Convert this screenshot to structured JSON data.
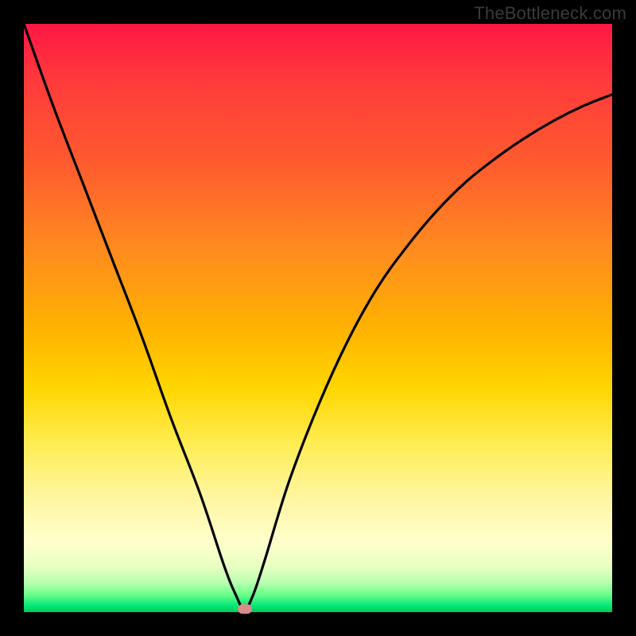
{
  "watermark": "TheBottleneck.com",
  "chart_data": {
    "type": "line",
    "title": "",
    "xlabel": "",
    "ylabel": "",
    "xlim": [
      0,
      100
    ],
    "ylim": [
      0,
      100
    ],
    "series": [
      {
        "name": "bottleneck-curve",
        "x": [
          0,
          5,
          10,
          15,
          20,
          25,
          30,
          34,
          36,
          37.5,
          39,
          41,
          45,
          50,
          55,
          60,
          65,
          70,
          75,
          80,
          85,
          90,
          95,
          100
        ],
        "y": [
          100,
          86,
          73,
          60,
          47,
          33,
          20,
          8,
          3,
          0.5,
          3,
          9,
          22,
          35,
          46,
          55,
          62,
          68,
          73,
          77,
          80.5,
          83.5,
          86,
          88
        ]
      }
    ],
    "minimum_marker": {
      "x": 37.5,
      "y": 0.5
    },
    "gradient_stops": [
      {
        "pct": 0,
        "color": "#ff1744"
      },
      {
        "pct": 50,
        "color": "#ffd600"
      },
      {
        "pct": 90,
        "color": "#ffffcc"
      },
      {
        "pct": 100,
        "color": "#00c853"
      }
    ]
  }
}
